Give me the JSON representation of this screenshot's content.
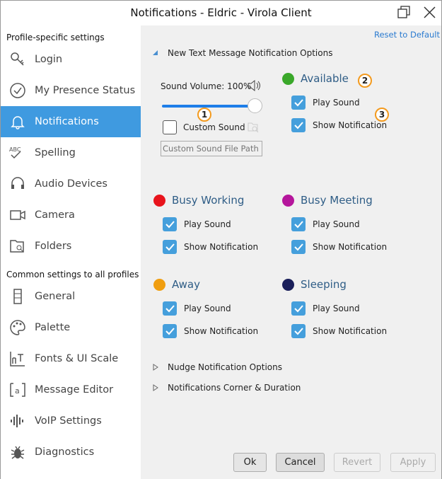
{
  "window": {
    "title": "Notifications - Eldric - Virola Client"
  },
  "sidebar": {
    "profile_header": "Profile-specific settings",
    "profile_items": [
      {
        "label": "Login",
        "icon": "key-icon"
      },
      {
        "label": "My Presence Status",
        "icon": "check-circle-icon"
      },
      {
        "label": "Notifications",
        "icon": "bell-icon",
        "active": true
      },
      {
        "label": "Spelling",
        "icon": "spelling-icon"
      },
      {
        "label": "Audio Devices",
        "icon": "headset-icon"
      },
      {
        "label": "Camera",
        "icon": "camera-icon"
      },
      {
        "label": "Folders",
        "icon": "folder-search-icon"
      }
    ],
    "common_header": "Common settings to all profiles",
    "common_items": [
      {
        "label": "General",
        "icon": "general-icon"
      },
      {
        "label": "Palette",
        "icon": "palette-icon"
      },
      {
        "label": "Fonts & UI Scale",
        "icon": "fonts-icon"
      },
      {
        "label": "Message Editor",
        "icon": "editor-icon"
      },
      {
        "label": "VoIP Settings",
        "icon": "voip-icon"
      },
      {
        "label": "Diagnostics",
        "icon": "bug-icon"
      }
    ]
  },
  "main": {
    "reset": "Reset to Default",
    "section_text": "New Text Message Notification Options",
    "volume_label": "Sound Volume: 100%",
    "volume_value": 100,
    "custom_sound": "Custom Sound",
    "custom_sound_checked": false,
    "path_placeholder": "Custom Sound File Path",
    "badges": [
      "1",
      "2",
      "3"
    ],
    "play": "Play Sound",
    "show": "Show Notification",
    "statuses": [
      {
        "name": "Available",
        "color": "#3aa82a",
        "play": true,
        "show": true
      },
      {
        "name": "Busy Working",
        "color": "#e8141c",
        "play": true,
        "show": true
      },
      {
        "name": "Busy Meeting",
        "color": "#b5169c",
        "play": true,
        "show": true
      },
      {
        "name": "Away",
        "color": "#f09e10",
        "play": true,
        "show": true
      },
      {
        "name": "Sleeping",
        "color": "#1a1f5a",
        "play": true,
        "show": true
      }
    ],
    "nudge": "Nudge Notification Options",
    "corner": "Notifications Corner & Duration"
  },
  "buttons": {
    "ok": "Ok",
    "cancel": "Cancel",
    "revert": "Revert",
    "apply": "Apply"
  }
}
